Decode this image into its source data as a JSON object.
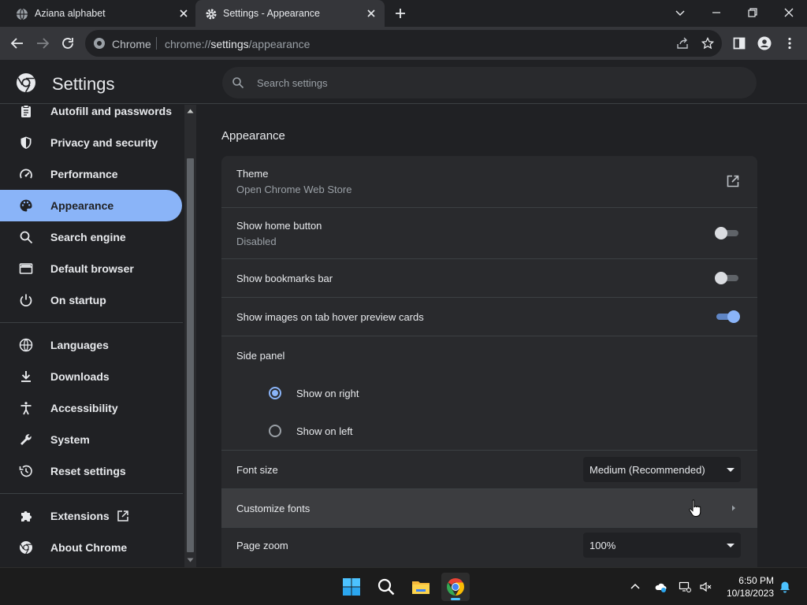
{
  "browser": {
    "tabs": [
      {
        "title": "Aziana alphabet",
        "icon": "globe-icon",
        "active": false
      },
      {
        "title": "Settings - Appearance",
        "icon": "gear-icon",
        "active": true
      }
    ],
    "omnibox": {
      "site_label": "Chrome",
      "url_prefix": "chrome://",
      "url_host": "settings",
      "url_path": "/appearance"
    }
  },
  "settings": {
    "title": "Settings",
    "search_placeholder": "Search settings"
  },
  "sidebar": {
    "items": [
      {
        "label": "Autofill and passwords",
        "icon": "clipboard-icon"
      },
      {
        "label": "Privacy and security",
        "icon": "shield-icon"
      },
      {
        "label": "Performance",
        "icon": "speedometer-icon"
      },
      {
        "label": "Appearance",
        "icon": "palette-icon",
        "active": true
      },
      {
        "label": "Search engine",
        "icon": "search-icon"
      },
      {
        "label": "Default browser",
        "icon": "browser-window-icon"
      },
      {
        "label": "On startup",
        "icon": "power-icon"
      },
      {
        "label": "Languages",
        "icon": "globe-icon"
      },
      {
        "label": "Downloads",
        "icon": "download-icon"
      },
      {
        "label": "Accessibility",
        "icon": "accessibility-icon"
      },
      {
        "label": "System",
        "icon": "wrench-icon"
      },
      {
        "label": "Reset settings",
        "icon": "history-icon"
      },
      {
        "label": "Extensions",
        "icon": "puzzle-icon"
      },
      {
        "label": "About Chrome",
        "icon": "chrome-icon"
      }
    ]
  },
  "appearance": {
    "section_title": "Appearance",
    "theme": {
      "label": "Theme",
      "sub": "Open Chrome Web Store"
    },
    "home_button": {
      "label": "Show home button",
      "sub": "Disabled",
      "enabled": false
    },
    "bookmarks_bar": {
      "label": "Show bookmarks bar",
      "enabled": false
    },
    "tab_hover_images": {
      "label": "Show images on tab hover preview cards",
      "enabled": true
    },
    "side_panel": {
      "label": "Side panel",
      "options": [
        {
          "label": "Show on right",
          "checked": true
        },
        {
          "label": "Show on left",
          "checked": false
        }
      ]
    },
    "font_size": {
      "label": "Font size",
      "value": "Medium (Recommended)"
    },
    "customize_fonts": {
      "label": "Customize fonts"
    },
    "page_zoom": {
      "label": "Page zoom",
      "value": "100%"
    }
  },
  "taskbar": {
    "apps": [
      "windows-start-icon",
      "search-icon",
      "file-explorer-icon",
      "chrome-icon"
    ],
    "time": "6:50 PM",
    "date": "10/18/2023"
  },
  "colors": {
    "accent": "#8ab4f8",
    "background": "#202124",
    "card": "#292a2d",
    "toolbar": "#35363a"
  }
}
